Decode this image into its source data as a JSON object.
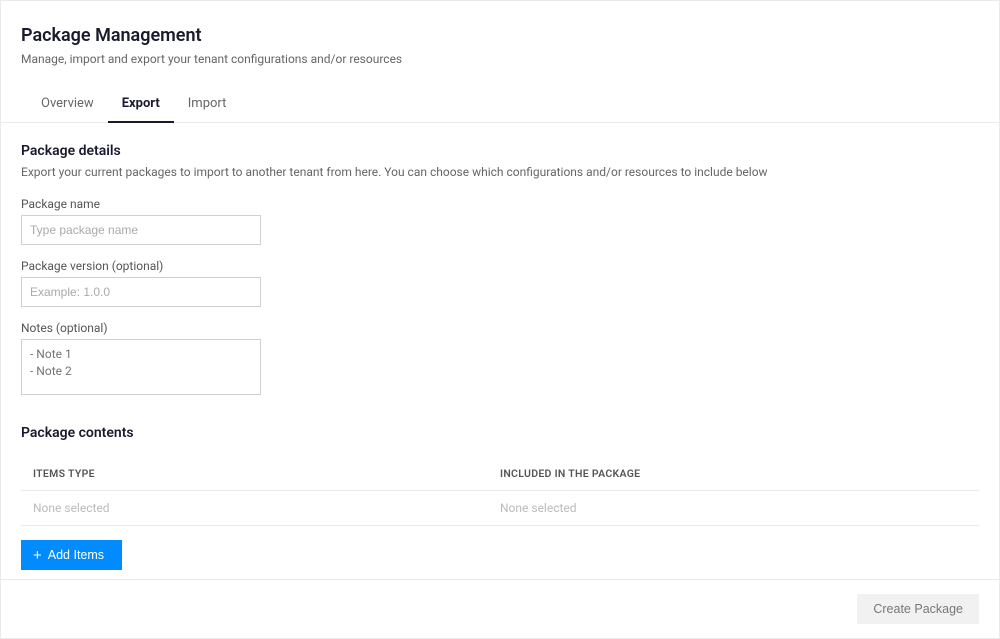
{
  "header": {
    "title": "Package Management",
    "subtitle": "Manage, import and export your tenant configurations and/or resources"
  },
  "tabs": {
    "items": [
      {
        "label": "Overview",
        "active": false
      },
      {
        "label": "Export",
        "active": true
      },
      {
        "label": "Import",
        "active": false
      }
    ]
  },
  "details": {
    "title": "Package details",
    "desc": "Export your current packages to import to another tenant from here. You can choose which configurations and/or resources to include below",
    "name_label": "Package name",
    "name_placeholder": "Type package name",
    "name_value": "",
    "version_label": "Package version (optional)",
    "version_placeholder": "Example: 1.0.0",
    "version_value": "",
    "notes_label": "Notes (optional)",
    "notes_placeholder": "- Note 1\n- Note 2",
    "notes_value": ""
  },
  "contents": {
    "title": "Package contents",
    "columns": {
      "type": "ITEMS TYPE",
      "included": "INCLUDED IN THE PACKAGE"
    },
    "rows": [
      {
        "type": "None selected",
        "included": "None selected"
      }
    ],
    "add_label": "Add Items"
  },
  "footer": {
    "create_label": "Create Package"
  }
}
